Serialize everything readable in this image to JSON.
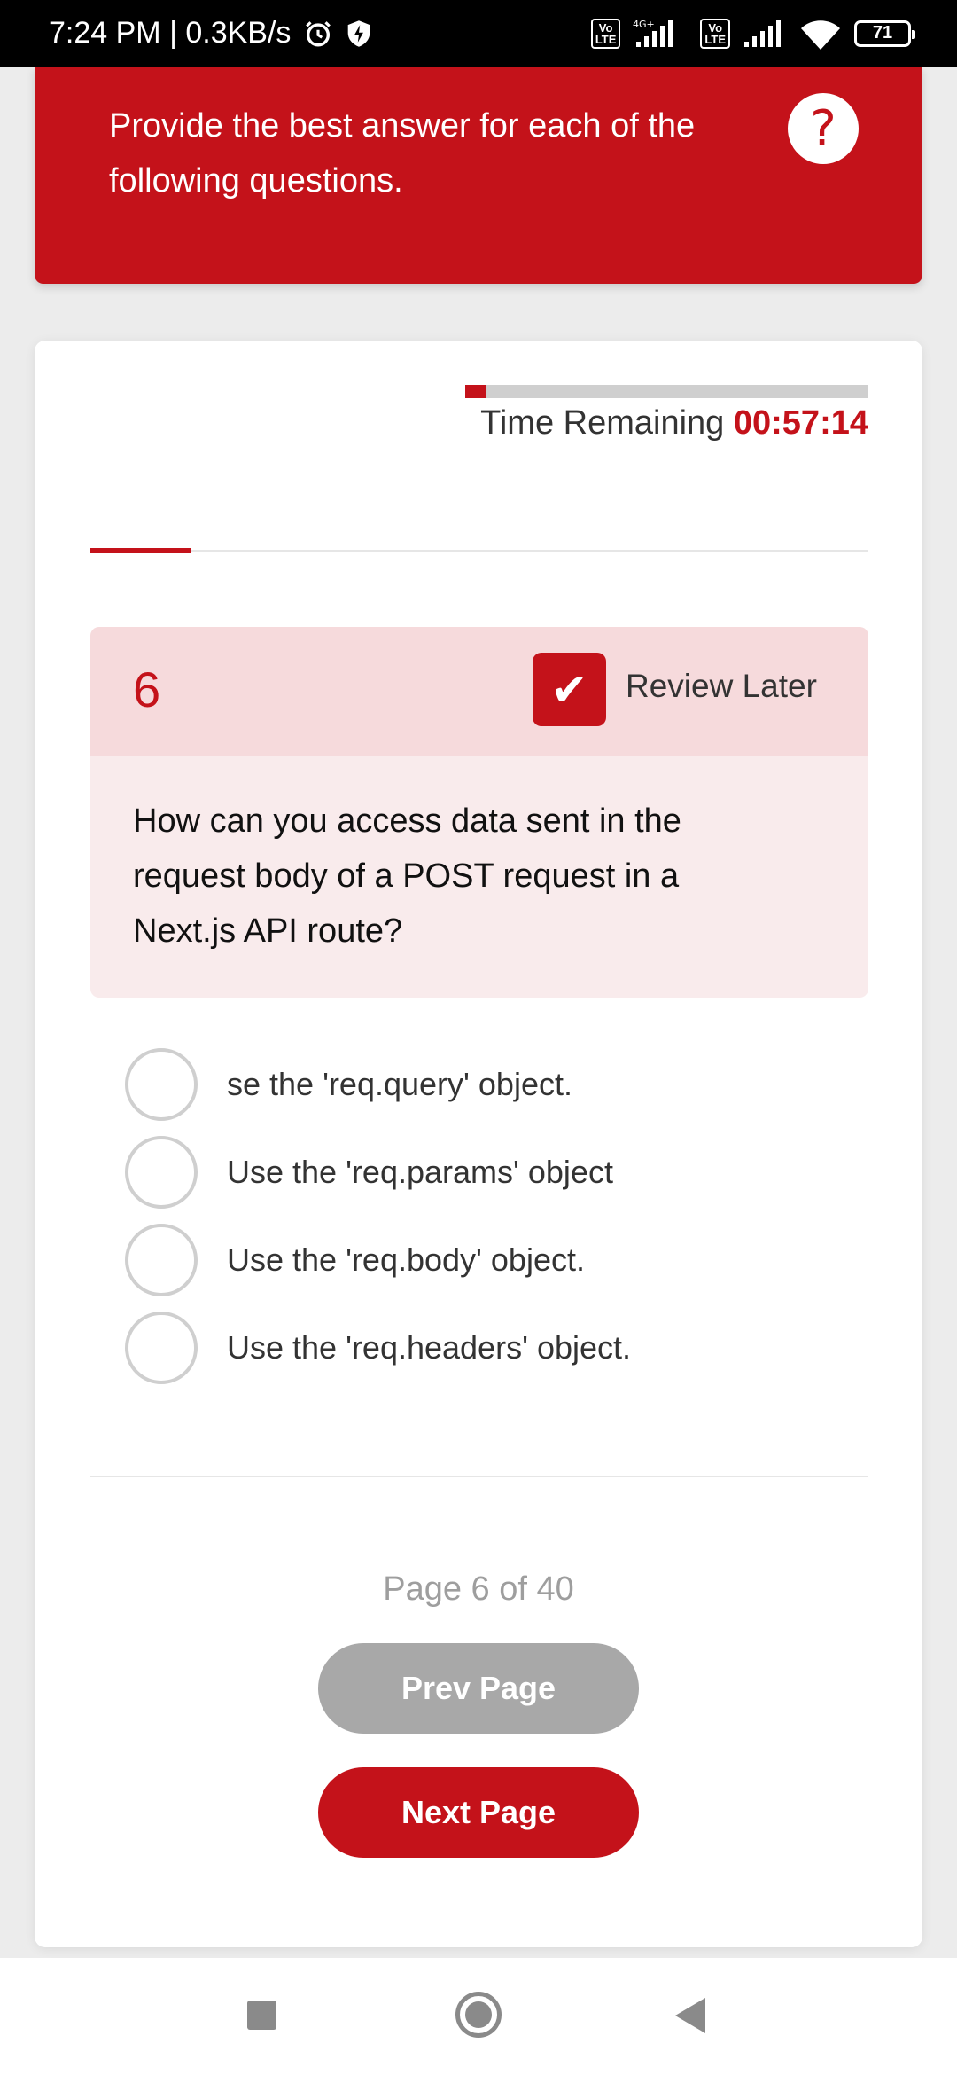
{
  "status_bar": {
    "time_speed": "7:24 PM | 0.3KB/s",
    "icons": [
      "alarm-icon",
      "shield-bolt-icon",
      "volte-icon",
      "signal-icon",
      "volte-icon",
      "signal-icon",
      "wifi-icon",
      "battery-icon"
    ],
    "network_label": "4G+",
    "volte_label": "Vo LTE",
    "battery": "71"
  },
  "banner": {
    "instructions": "Provide the best answer for each of the following questions.",
    "help_icon": "?"
  },
  "timer": {
    "label": "Time Remaining ",
    "value": "00:57:14",
    "progress_fraction": 0.05
  },
  "question": {
    "number": "6",
    "review_label": "Review Later",
    "review_checked": true,
    "text": "How can you access data sent in the request body of a POST request in a Next.js API route?",
    "options": [
      "se the 'req.query' object.",
      "Use the 'req.params' object",
      "Use the 'req.body' object.",
      "Use the 'req.headers' object."
    ]
  },
  "pagination": {
    "indicator": "Page 6 of 40",
    "prev_label": "Prev Page",
    "next_label": "Next Page"
  },
  "colors": {
    "accent": "#c4121a",
    "header_tint": "#f6dadc",
    "body_tint": "#f9ebec",
    "disabled": "#a8a8a8"
  }
}
